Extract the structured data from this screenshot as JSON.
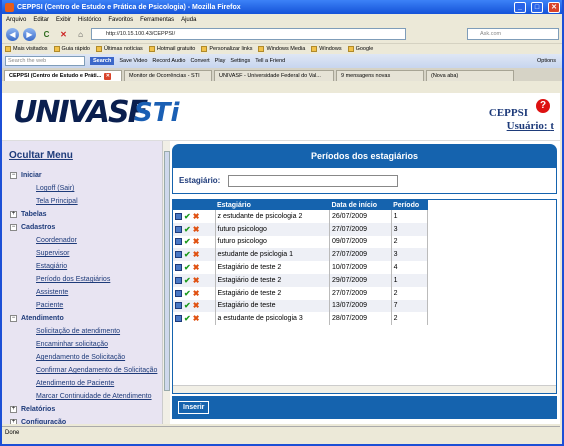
{
  "window": {
    "title": "CEPPSI (Centro de Estudo e Prática de Psicologia) - Mozilla Firefox"
  },
  "menubar": [
    "Arquivo",
    "Editar",
    "Exibir",
    "Histórico",
    "Favoritos",
    "Ferramentas",
    "Ajuda"
  ],
  "nav": {
    "url": "http://10.15.100.43/CEPPSI/",
    "search_placeholder": "Ask.com"
  },
  "bookmarks": [
    "Mais visitados",
    "Guia rápido",
    "Últimas notícias",
    "Hotmail gratuito",
    "Personalizar links",
    "Windows Media",
    "Windows",
    "Google"
  ],
  "toolbar2": {
    "search_placeholder": "Search the web",
    "search_btn": "Search",
    "items": [
      "Save Video",
      "Record Audio",
      "Convert",
      "Play",
      "Settings",
      "Tell a Friend"
    ],
    "options": "Options"
  },
  "tabs": [
    "CEPPSI (Centro de Estudo e Práti...",
    "Monitor de Ocorrências - STI",
    "UNIVASF - Universidade Federal do Val...",
    "9 mensagens novas",
    "(Nova aba)"
  ],
  "header": {
    "logo_main": "UNIVASF",
    "logo_sti": "STi",
    "system": "CEPPSI",
    "user_label": "Usuário:",
    "user_value": "t"
  },
  "sidebar": {
    "toggle": "Ocultar Menu",
    "sections": [
      {
        "label": "Iniciar",
        "open": true,
        "links": [
          "Logoff (Sair)",
          "Tela Principal"
        ]
      },
      {
        "label": "Tabelas",
        "open": false,
        "links": []
      },
      {
        "label": "Cadastros",
        "open": true,
        "links": [
          "Coordenador",
          "Supervisor",
          "Estagiário",
          "Período dos Estagiários",
          "Assistente",
          "Paciente"
        ]
      },
      {
        "label": "Atendimento",
        "open": true,
        "links": [
          "Solicitação de atendimento",
          "Encaminhar solicitação",
          "Agendamento de Solicitação",
          "Confirmar Agendamento de Solicitação",
          "Atendimento de Paciente",
          "Marcar Continuidade de Atendimento"
        ]
      },
      {
        "label": "Relatórios",
        "open": false,
        "links": []
      },
      {
        "label": "Configuração",
        "open": false,
        "links": []
      }
    ]
  },
  "main": {
    "title": "Períodos dos estagiários",
    "filter_label": "Estagiário:",
    "columns": [
      "Estagiário",
      "Data de início",
      "Período"
    ],
    "rows": [
      [
        "z estudante de psicologia 2",
        "26/07/2009",
        "1"
      ],
      [
        "futuro psicologo",
        "27/07/2009",
        "3"
      ],
      [
        "futuro psicologo",
        "09/07/2009",
        "2"
      ],
      [
        "estudante de psiclogia 1",
        "27/07/2009",
        "3"
      ],
      [
        "Estagiário de teste 2",
        "10/07/2009",
        "4"
      ],
      [
        "Estagiário de teste 2",
        "29/07/2009",
        "1"
      ],
      [
        "Estagiário de teste 2",
        "27/07/2009",
        "2"
      ],
      [
        "Estagiário de teste",
        "13/07/2009",
        "7"
      ],
      [
        "a estudante de psicologia 3",
        "28/07/2009",
        "2"
      ]
    ],
    "insert_button": "Inserir"
  },
  "status": "Done"
}
